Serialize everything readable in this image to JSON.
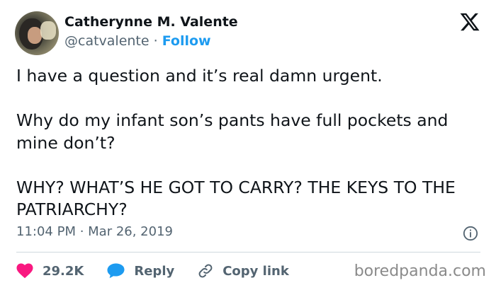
{
  "author": {
    "name": "Catherynne M. Valente",
    "handle": "@catvalente",
    "separator": "·",
    "follow_label": "Follow"
  },
  "tweet": {
    "paragraphs": [
      "I have a question and it’s real damn urgent.",
      "Why do my infant son’s pants have full pockets and mine don’t?",
      "WHY? WHAT’S HE GOT TO CARRY? THE KEYS TO THE PATRIARCHY?"
    ],
    "timestamp": "11:04 PM · Mar 26, 2019"
  },
  "actions": {
    "likes": "29.2K",
    "reply_label": "Reply",
    "copy_link_label": "Copy link"
  },
  "watermark": "boredpanda.com",
  "colors": {
    "like_heart": "#f91880",
    "reply_bubble": "#1d9bf0",
    "follow": "#1d9bf0",
    "secondary_text": "#536471"
  },
  "icons": [
    "x-logo-icon",
    "info-icon",
    "heart-icon",
    "reply-bubble-icon",
    "link-icon"
  ]
}
